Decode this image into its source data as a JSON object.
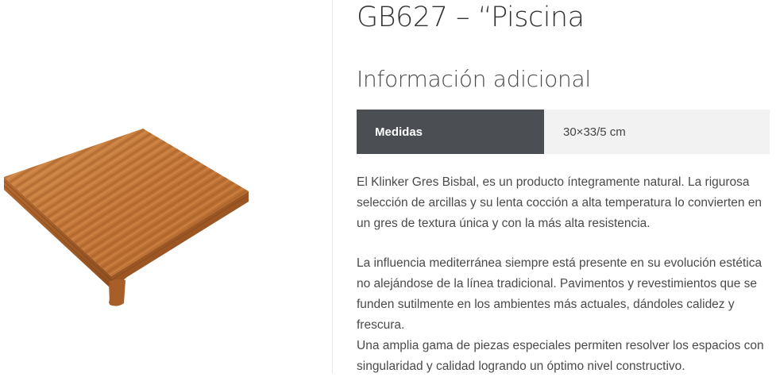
{
  "product": {
    "title": "GB627 – “Piscina"
  },
  "additional_info": {
    "heading": "Información adicional",
    "attributes": [
      {
        "label": "Medidas",
        "value": "30×33/5 cm"
      }
    ]
  },
  "description": {
    "paragraphs": [
      "El Klinker Gres Bisbal, es un producto íntegramente natural. La rigurosa selección de arcillas y su lenta cocción a alta temperatura lo convierten en un gres de textura única y con la más alta resistencia.",
      "La influencia mediterránea siempre está presente en su evolución estética no alejándose de la línea tradicional. Pavimentos y revestimientos que se funden sutilmente en los ambientes más actuales, dándoles calidez y frescura.",
      "Una amplia gama de piezas especiales permiten resolver los espacios con singularidad y calidad logrando un óptimo nivel constructivo."
    ]
  },
  "colors": {
    "tile_top": "#c67a3a",
    "tile_side": "#a85f27",
    "table_label_bg": "#4b4f53",
    "table_value_bg": "#f2f2f2"
  }
}
